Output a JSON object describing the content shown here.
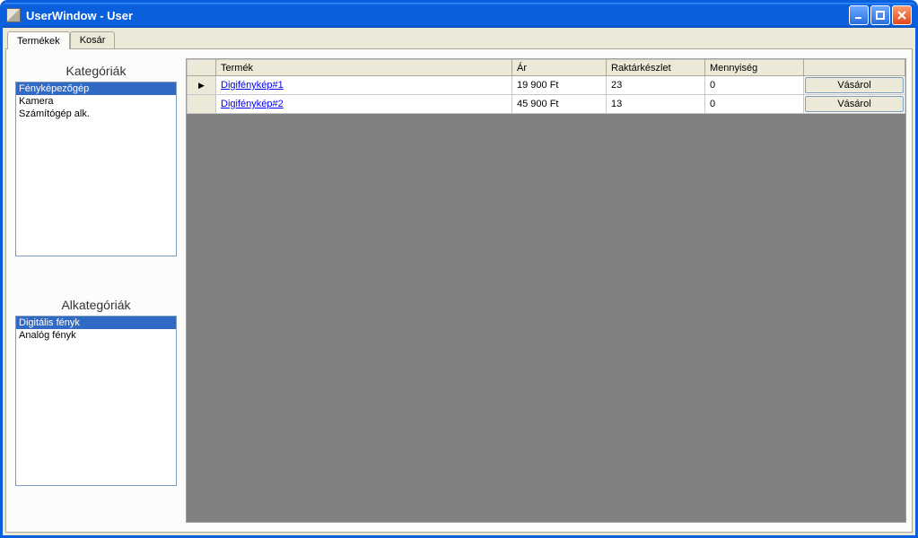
{
  "window": {
    "title": "UserWindow - User"
  },
  "tabs": [
    {
      "label": "Termékek",
      "active": true
    },
    {
      "label": "Kosár",
      "active": false
    }
  ],
  "sidebar": {
    "categories_heading": "Kategóriák",
    "categories": [
      {
        "label": "Fényképezőgép",
        "selected": true
      },
      {
        "label": "Kamera",
        "selected": false
      },
      {
        "label": "Számítógép alk.",
        "selected": false
      }
    ],
    "subcategories_heading": "Alkategóriák",
    "subcategories": [
      {
        "label": "Digitális fényk",
        "selected": true
      },
      {
        "label": "Analóg fényk",
        "selected": false
      }
    ]
  },
  "grid": {
    "columns": {
      "product": "Termék",
      "price": "Ár",
      "stock": "Raktárkészlet",
      "quantity": "Mennyiség",
      "buy_button": "Vásárol"
    },
    "rows": [
      {
        "product": "Digifénykép#1",
        "price": "19 900 Ft",
        "stock": "23",
        "quantity": "0",
        "current": true
      },
      {
        "product": "Digifénykép#2",
        "price": "45 900 Ft",
        "stock": "13",
        "quantity": "0",
        "current": false
      }
    ]
  }
}
